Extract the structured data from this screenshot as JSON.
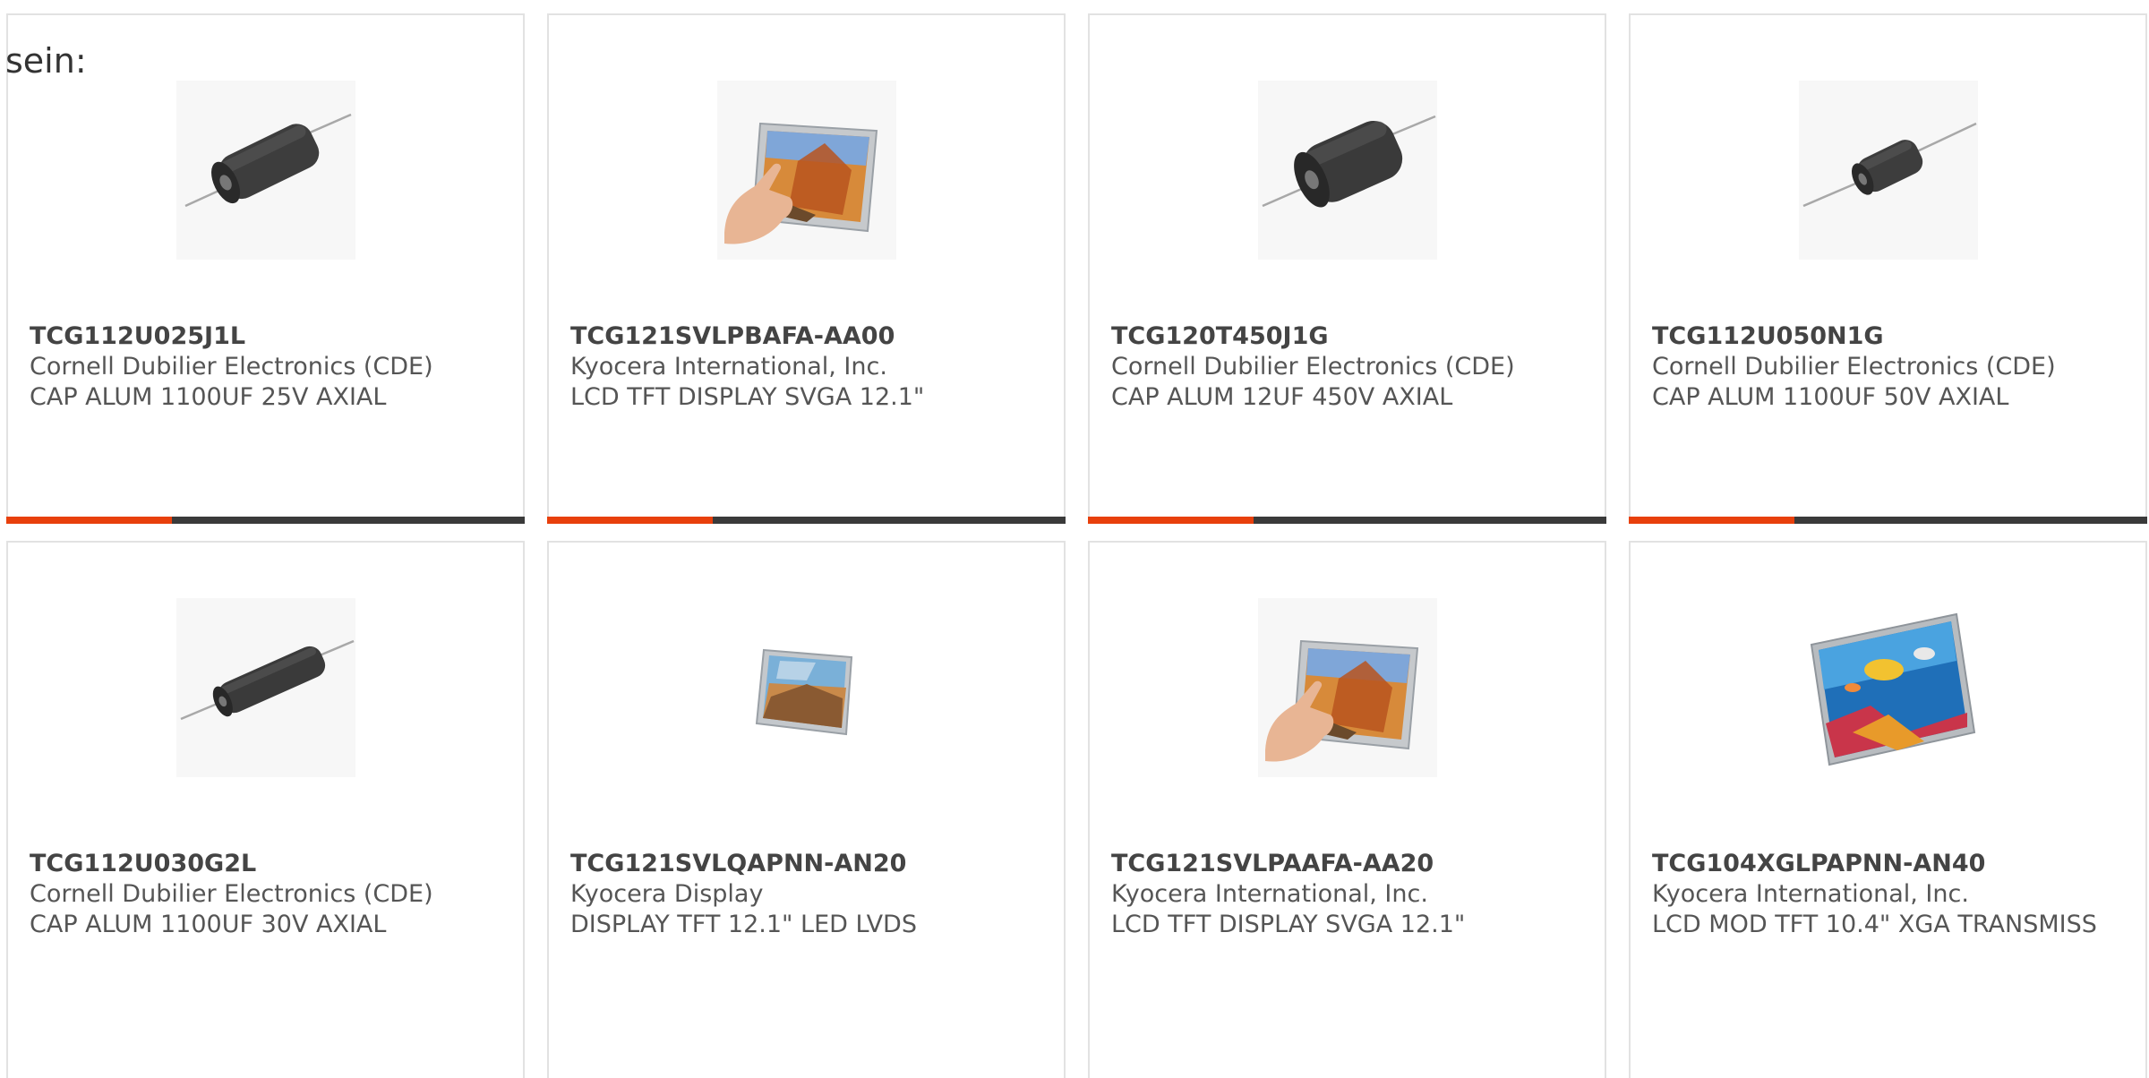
{
  "lead_text": "sein:",
  "colors": {
    "accent": "#e8400c",
    "bar_dark": "#3a3a3a",
    "card_border": "#e2e2e2",
    "part_text": "#444444",
    "body_text": "#555555"
  },
  "products": [
    {
      "part_number": "TCG112U025J1L",
      "manufacturer": "Cornell Dubilier Electronics (CDE)",
      "description": "CAP ALUM 1100UF 25V AXIAL",
      "image_icon": "axial-capacitor-icon",
      "accent_fraction": 0.32
    },
    {
      "part_number": "TCG121SVLPBAFA-AA00",
      "manufacturer": "Kyocera International, Inc.",
      "description": "LCD TFT DISPLAY SVGA 12.1\"",
      "image_icon": "touch-display-icon",
      "accent_fraction": 0.32
    },
    {
      "part_number": "TCG120T450J1G",
      "manufacturer": "Cornell Dubilier Electronics (CDE)",
      "description": "CAP ALUM 12UF 450V AXIAL",
      "image_icon": "axial-capacitor-icon",
      "accent_fraction": 0.32
    },
    {
      "part_number": "TCG112U050N1G",
      "manufacturer": "Cornell Dubilier Electronics (CDE)",
      "description": "CAP ALUM 1100UF 50V AXIAL",
      "image_icon": "axial-capacitor-icon",
      "accent_fraction": 0.32
    },
    {
      "part_number": "TCG112U030G2L",
      "manufacturer": "Cornell Dubilier Electronics (CDE)",
      "description": "CAP ALUM 1100UF 30V AXIAL",
      "image_icon": "axial-capacitor-icon"
    },
    {
      "part_number": "TCG121SVLQAPNN-AN20",
      "manufacturer": "Kyocera Display",
      "description": "DISPLAY TFT 12.1\" LED LVDS",
      "image_icon": "lcd-panel-icon"
    },
    {
      "part_number": "TCG121SVLPAAFA-AA20",
      "manufacturer": "Kyocera International, Inc.",
      "description": "LCD TFT DISPLAY SVGA 12.1\"",
      "image_icon": "touch-display-icon"
    },
    {
      "part_number": "TCG104XGLPAPNN-AN40",
      "manufacturer": "Kyocera International, Inc.",
      "description": "LCD MOD TFT 10.4\" XGA TRANSMISS",
      "image_icon": "lcd-panel-icon"
    }
  ]
}
